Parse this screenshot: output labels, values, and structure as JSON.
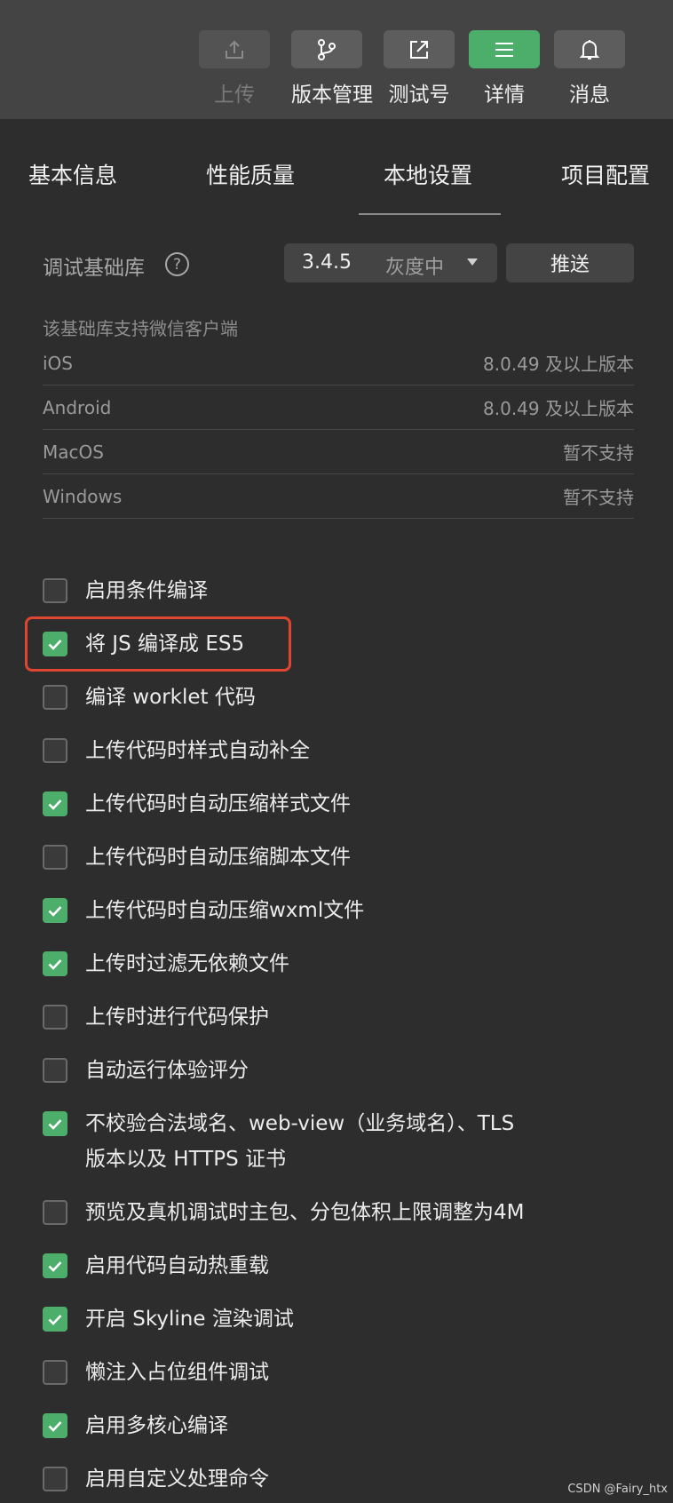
{
  "toolbar": {
    "buttons": [
      {
        "label": "上传",
        "icon": "upload-icon",
        "disabled": true
      },
      {
        "label": "版本管理",
        "icon": "branch-icon"
      },
      {
        "label": "测试号",
        "icon": "external-link-icon"
      },
      {
        "label": "详情",
        "icon": "list-icon",
        "active": true
      },
      {
        "label": "消息",
        "icon": "bell-icon"
      }
    ]
  },
  "tabs": [
    "基本信息",
    "性能质量",
    "本地设置",
    "项目配置"
  ],
  "active_tab": "本地设置",
  "debug_lib": {
    "label": "调试基础库",
    "help": "?",
    "version": "3.4.5",
    "status": "灰度中",
    "push_label": "推送"
  },
  "support": {
    "title": "该基础库支持微信客户端",
    "rows": [
      {
        "platform": "iOS",
        "value": "8.0.49 及以上版本"
      },
      {
        "platform": "Android",
        "value": "8.0.49 及以上版本"
      },
      {
        "platform": "MacOS",
        "value": "暂不支持"
      },
      {
        "platform": "Windows",
        "value": "暂不支持"
      }
    ]
  },
  "options": [
    {
      "label": "启用条件编译",
      "checked": false
    },
    {
      "label": "将 JS 编译成 ES5",
      "checked": true
    },
    {
      "label": "编译 worklet 代码",
      "checked": false
    },
    {
      "label": "上传代码时样式自动补全",
      "checked": false
    },
    {
      "label": "上传代码时自动压缩样式文件",
      "checked": true
    },
    {
      "label": "上传代码时自动压缩脚本文件",
      "checked": false
    },
    {
      "label": "上传代码时自动压缩wxml文件",
      "checked": true
    },
    {
      "label": "上传时过滤无依赖文件",
      "checked": true
    },
    {
      "label": "上传时进行代码保护",
      "checked": false
    },
    {
      "label": "自动运行体验评分",
      "checked": false
    },
    {
      "label": "不校验合法域名、web-view（业务域名）、TLS\n版本以及 HTTPS 证书",
      "checked": true
    },
    {
      "label": "预览及真机调试时主包、分包体积上限调整为4M",
      "checked": false
    },
    {
      "label": "启用代码自动热重载",
      "checked": true
    },
    {
      "label": "开启 Skyline 渲染调试",
      "checked": true
    },
    {
      "label": "懒注入占位组件调试",
      "checked": false
    },
    {
      "label": "启用多核心编译",
      "checked": true
    },
    {
      "label": "启用自定义处理命令",
      "checked": false
    }
  ],
  "watermark": "CSDN @Fairy_htx",
  "colors": {
    "accent": "#4dae6b",
    "highlight": "#e0462f",
    "background": "#2d2d2d",
    "toolbar": "#444444"
  }
}
